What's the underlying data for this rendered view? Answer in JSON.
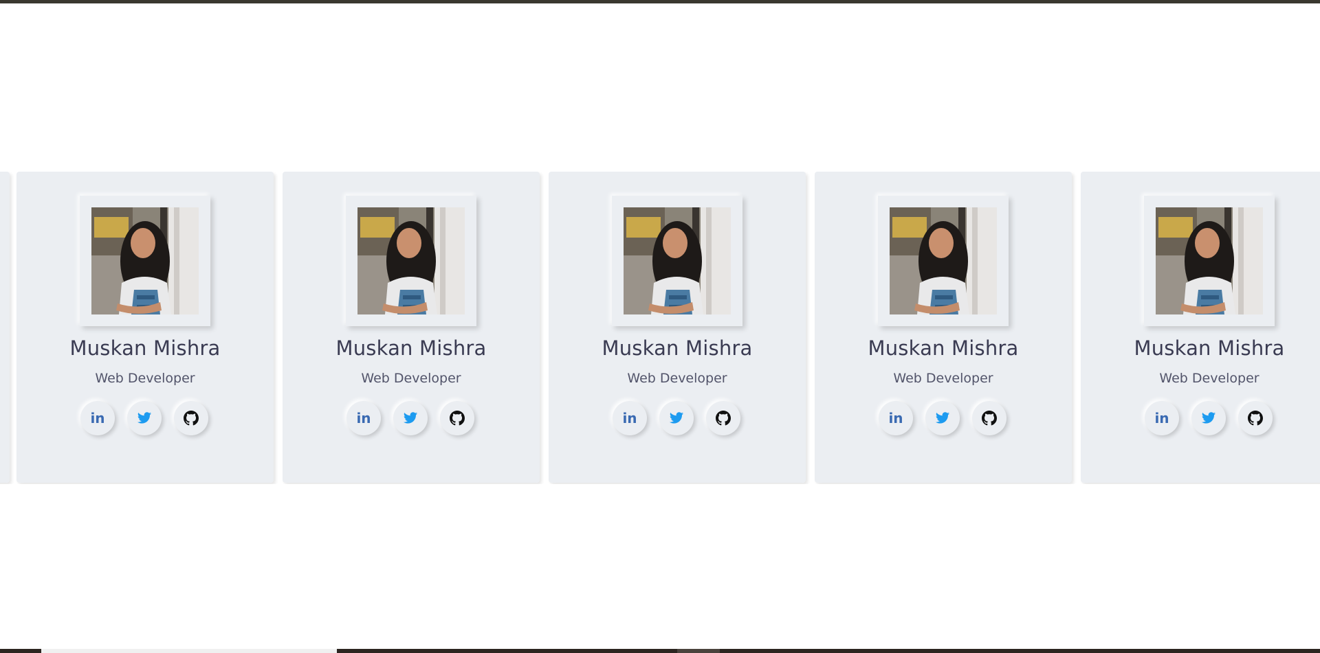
{
  "carousel": {
    "cards": [
      {
        "name": "Muskan Mishra",
        "role": "Web Developer",
        "socials": {
          "linkedin": "in"
        }
      },
      {
        "name": "Muskan Mishra",
        "role": "Web Developer",
        "socials": {
          "linkedin": "in"
        }
      },
      {
        "name": "Muskan Mishra",
        "role": "Web Developer",
        "socials": {
          "linkedin": "in"
        }
      },
      {
        "name": "Muskan Mishra",
        "role": "Web Developer",
        "socials": {
          "linkedin": "in"
        }
      },
      {
        "name": "Muskan Mishra",
        "role": "Web Developer",
        "socials": {
          "linkedin": "in"
        }
      }
    ],
    "social_icons": [
      "linkedin-icon",
      "twitter-icon",
      "github-icon"
    ]
  },
  "colors": {
    "card_background": "#ebeef2",
    "name_text": "#3a3b52",
    "linkedin": "#3a6ab2",
    "twitter": "#1d9bf0",
    "github": "#111111"
  }
}
